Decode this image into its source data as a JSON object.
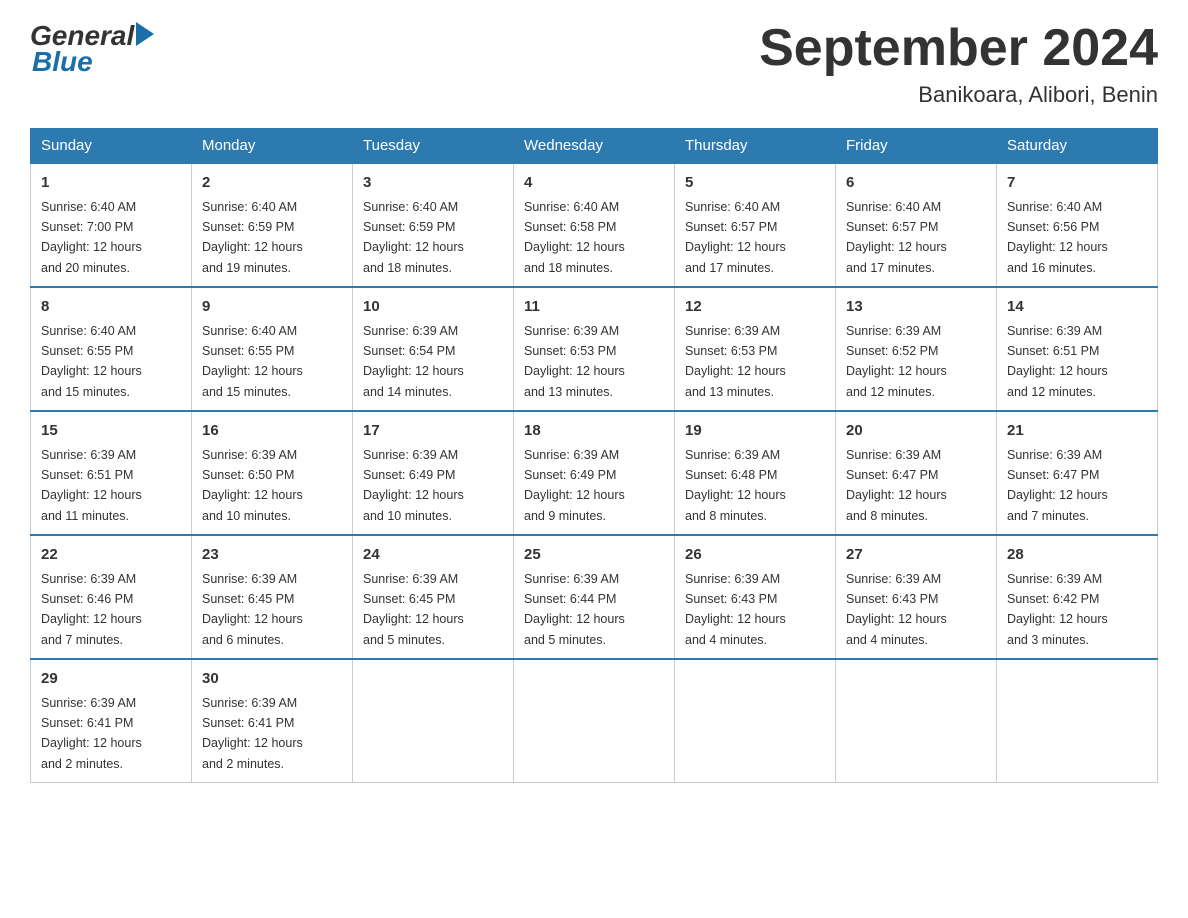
{
  "header": {
    "logo": {
      "general": "General",
      "blue": "Blue"
    },
    "title": "September 2024",
    "subtitle": "Banikoara, Alibori, Benin"
  },
  "weekdays": [
    "Sunday",
    "Monday",
    "Tuesday",
    "Wednesday",
    "Thursday",
    "Friday",
    "Saturday"
  ],
  "weeks": [
    [
      {
        "day": "1",
        "sunrise": "6:40 AM",
        "sunset": "7:00 PM",
        "daylight": "12 hours and 20 minutes."
      },
      {
        "day": "2",
        "sunrise": "6:40 AM",
        "sunset": "6:59 PM",
        "daylight": "12 hours and 19 minutes."
      },
      {
        "day": "3",
        "sunrise": "6:40 AM",
        "sunset": "6:59 PM",
        "daylight": "12 hours and 18 minutes."
      },
      {
        "day": "4",
        "sunrise": "6:40 AM",
        "sunset": "6:58 PM",
        "daylight": "12 hours and 18 minutes."
      },
      {
        "day": "5",
        "sunrise": "6:40 AM",
        "sunset": "6:57 PM",
        "daylight": "12 hours and 17 minutes."
      },
      {
        "day": "6",
        "sunrise": "6:40 AM",
        "sunset": "6:57 PM",
        "daylight": "12 hours and 17 minutes."
      },
      {
        "day": "7",
        "sunrise": "6:40 AM",
        "sunset": "6:56 PM",
        "daylight": "12 hours and 16 minutes."
      }
    ],
    [
      {
        "day": "8",
        "sunrise": "6:40 AM",
        "sunset": "6:55 PM",
        "daylight": "12 hours and 15 minutes."
      },
      {
        "day": "9",
        "sunrise": "6:40 AM",
        "sunset": "6:55 PM",
        "daylight": "12 hours and 15 minutes."
      },
      {
        "day": "10",
        "sunrise": "6:39 AM",
        "sunset": "6:54 PM",
        "daylight": "12 hours and 14 minutes."
      },
      {
        "day": "11",
        "sunrise": "6:39 AM",
        "sunset": "6:53 PM",
        "daylight": "12 hours and 13 minutes."
      },
      {
        "day": "12",
        "sunrise": "6:39 AM",
        "sunset": "6:53 PM",
        "daylight": "12 hours and 13 minutes."
      },
      {
        "day": "13",
        "sunrise": "6:39 AM",
        "sunset": "6:52 PM",
        "daylight": "12 hours and 12 minutes."
      },
      {
        "day": "14",
        "sunrise": "6:39 AM",
        "sunset": "6:51 PM",
        "daylight": "12 hours and 12 minutes."
      }
    ],
    [
      {
        "day": "15",
        "sunrise": "6:39 AM",
        "sunset": "6:51 PM",
        "daylight": "12 hours and 11 minutes."
      },
      {
        "day": "16",
        "sunrise": "6:39 AM",
        "sunset": "6:50 PM",
        "daylight": "12 hours and 10 minutes."
      },
      {
        "day": "17",
        "sunrise": "6:39 AM",
        "sunset": "6:49 PM",
        "daylight": "12 hours and 10 minutes."
      },
      {
        "day": "18",
        "sunrise": "6:39 AM",
        "sunset": "6:49 PM",
        "daylight": "12 hours and 9 minutes."
      },
      {
        "day": "19",
        "sunrise": "6:39 AM",
        "sunset": "6:48 PM",
        "daylight": "12 hours and 8 minutes."
      },
      {
        "day": "20",
        "sunrise": "6:39 AM",
        "sunset": "6:47 PM",
        "daylight": "12 hours and 8 minutes."
      },
      {
        "day": "21",
        "sunrise": "6:39 AM",
        "sunset": "6:47 PM",
        "daylight": "12 hours and 7 minutes."
      }
    ],
    [
      {
        "day": "22",
        "sunrise": "6:39 AM",
        "sunset": "6:46 PM",
        "daylight": "12 hours and 7 minutes."
      },
      {
        "day": "23",
        "sunrise": "6:39 AM",
        "sunset": "6:45 PM",
        "daylight": "12 hours and 6 minutes."
      },
      {
        "day": "24",
        "sunrise": "6:39 AM",
        "sunset": "6:45 PM",
        "daylight": "12 hours and 5 minutes."
      },
      {
        "day": "25",
        "sunrise": "6:39 AM",
        "sunset": "6:44 PM",
        "daylight": "12 hours and 5 minutes."
      },
      {
        "day": "26",
        "sunrise": "6:39 AM",
        "sunset": "6:43 PM",
        "daylight": "12 hours and 4 minutes."
      },
      {
        "day": "27",
        "sunrise": "6:39 AM",
        "sunset": "6:43 PM",
        "daylight": "12 hours and 4 minutes."
      },
      {
        "day": "28",
        "sunrise": "6:39 AM",
        "sunset": "6:42 PM",
        "daylight": "12 hours and 3 minutes."
      }
    ],
    [
      {
        "day": "29",
        "sunrise": "6:39 AM",
        "sunset": "6:41 PM",
        "daylight": "12 hours and 2 minutes."
      },
      {
        "day": "30",
        "sunrise": "6:39 AM",
        "sunset": "6:41 PM",
        "daylight": "12 hours and 2 minutes."
      },
      null,
      null,
      null,
      null,
      null
    ]
  ],
  "labels": {
    "sunrise": "Sunrise:",
    "sunset": "Sunset:",
    "daylight": "Daylight:"
  }
}
